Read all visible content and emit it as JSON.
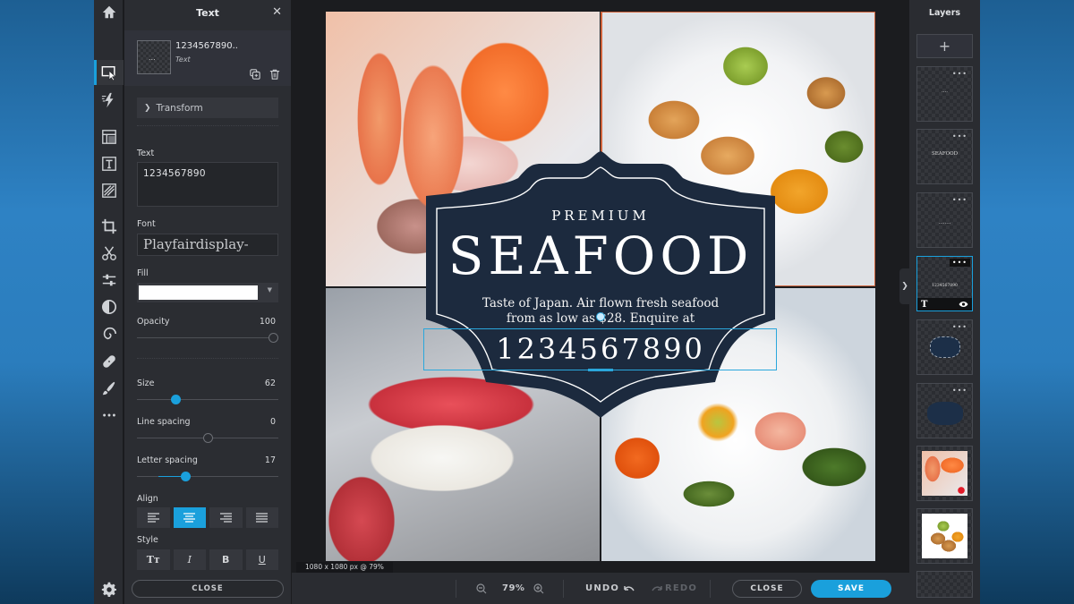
{
  "rail": {
    "tools": [
      {
        "id": "home",
        "icon": "home-icon"
      },
      {
        "id": "select",
        "icon": "select-cursor-icon",
        "active": true
      },
      {
        "id": "effects",
        "icon": "lightning-icon"
      },
      {
        "id": "layout",
        "icon": "layout-icon"
      },
      {
        "id": "text",
        "icon": "text-icon"
      },
      {
        "id": "pattern",
        "icon": "pattern-icon"
      },
      {
        "id": "crop",
        "icon": "crop-icon"
      },
      {
        "id": "cutout",
        "icon": "scissors-icon"
      },
      {
        "id": "adjust",
        "icon": "sliders-icon"
      },
      {
        "id": "filter",
        "icon": "contrast-icon"
      },
      {
        "id": "liquify",
        "icon": "spiral-icon"
      },
      {
        "id": "heal",
        "icon": "bandage-icon"
      },
      {
        "id": "brush",
        "icon": "brush-icon"
      },
      {
        "id": "more",
        "icon": "more-icon"
      },
      {
        "id": "settings",
        "icon": "gear-icon"
      }
    ]
  },
  "panel": {
    "title": "Text",
    "layer_name": "1234567890..",
    "layer_type": "Text",
    "transform_label": "Transform",
    "text_label": "Text",
    "text_value": "1234567890",
    "font_label": "Font",
    "font_value": "Playfairdisplay-",
    "fill_label": "Fill",
    "fill_color": "#ffffff",
    "opacity_label": "Opacity",
    "opacity_value": "100",
    "opacity_fraction": 1.0,
    "size_label": "Size",
    "size_value": "62",
    "size_fraction": 0.26,
    "line_spacing_label": "Line spacing",
    "line_spacing_value": "0",
    "line_spacing_fraction": 0.5,
    "letter_spacing_label": "Letter spacing",
    "letter_spacing_value": "17",
    "letter_spacing_fraction": 0.33,
    "align_label": "Align",
    "align_options": [
      "left",
      "center",
      "right",
      "justify"
    ],
    "align_selected": "center",
    "style_label": "Style",
    "style_options": {
      "case": "Tт",
      "italic": "I",
      "bold": "B",
      "underline": "U"
    },
    "close_label": "CLOSE"
  },
  "canvas": {
    "premium": "PREMIUM",
    "seafood": "SEAFOOD",
    "tagline_line1": "Taste of Japan. Air flown fresh seafood",
    "tagline_line2": "from as low as $28. Enquire at",
    "phone": "1234567890",
    "dimensions": "1080 x 1080 px @ 79%"
  },
  "bottombar": {
    "zoom_value": "79%",
    "undo_label": "UNDO",
    "redo_label": "REDO",
    "close_label": "CLOSE",
    "save_label": "SAVE"
  },
  "layers": {
    "title": "Layers",
    "add_label": "+",
    "items": [
      {
        "type": "text",
        "preview": "....",
        "selected": false
      },
      {
        "type": "text",
        "preview": "SEAFOOD",
        "selected": false
      },
      {
        "type": "text",
        "preview": "........",
        "selected": false
      },
      {
        "type": "text",
        "preview": "1234567890",
        "selected": true
      },
      {
        "type": "shape",
        "preview": "badge outline",
        "selected": false
      },
      {
        "type": "shape",
        "preview": "badge fill",
        "selected": false
      },
      {
        "type": "image",
        "preview": "sashimi photo",
        "selected": false
      },
      {
        "type": "image",
        "preview": "scallops photo",
        "selected": false
      }
    ]
  },
  "colors": {
    "accent": "#1aa0dc",
    "badge_navy": "#1c2a3e",
    "guide": "#d0643c"
  }
}
